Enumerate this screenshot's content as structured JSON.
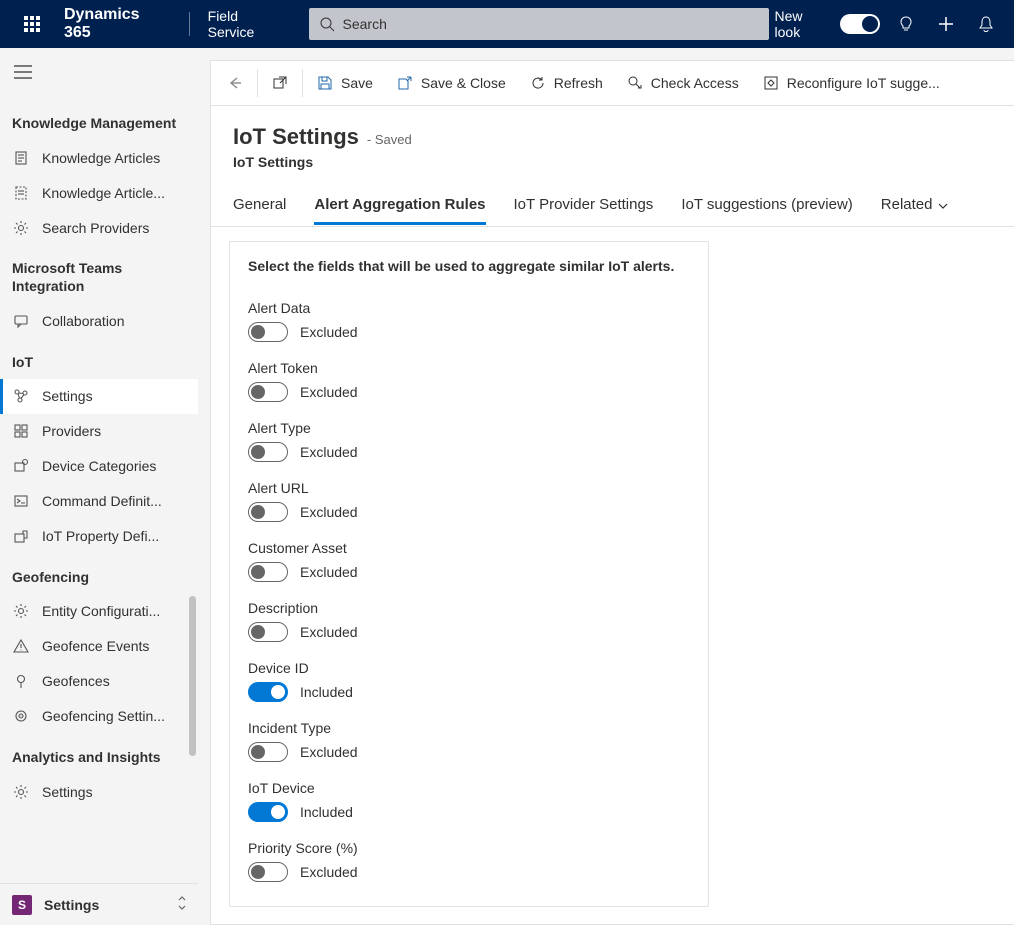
{
  "header": {
    "brand": "Dynamics 365",
    "app": "Field Service",
    "search_placeholder": "Search",
    "new_look_label": "New look"
  },
  "sidebar": {
    "groups": [
      {
        "title": "Knowledge Management",
        "items": [
          {
            "id": "knowledge-articles",
            "label": "Knowledge Articles",
            "icon": "doc"
          },
          {
            "id": "knowledge-article-templates",
            "label": "Knowledge Article...",
            "icon": "doc-dash"
          },
          {
            "id": "search-providers",
            "label": "Search Providers",
            "icon": "gear"
          }
        ]
      },
      {
        "title": "Microsoft Teams Integration",
        "items": [
          {
            "id": "collaboration",
            "label": "Collaboration",
            "icon": "chat"
          }
        ]
      },
      {
        "title": "IoT",
        "items": [
          {
            "id": "iot-settings",
            "label": "Settings",
            "icon": "nodes",
            "selected": true
          },
          {
            "id": "providers",
            "label": "Providers",
            "icon": "grid"
          },
          {
            "id": "device-categories",
            "label": "Device Categories",
            "icon": "device"
          },
          {
            "id": "command-definitions",
            "label": "Command Definit...",
            "icon": "cmd"
          },
          {
            "id": "iot-property-definitions",
            "label": "IoT Property Defi...",
            "icon": "prop"
          }
        ]
      },
      {
        "title": "Geofencing",
        "items": [
          {
            "id": "entity-config",
            "label": "Entity Configurati...",
            "icon": "gear"
          },
          {
            "id": "geofence-events",
            "label": "Geofence Events",
            "icon": "warn"
          },
          {
            "id": "geofences",
            "label": "Geofences",
            "icon": "pin"
          },
          {
            "id": "geofencing-settings",
            "label": "Geofencing Settin...",
            "icon": "target"
          }
        ]
      },
      {
        "title": "Analytics and Insights",
        "items": [
          {
            "id": "analytics-settings",
            "label": "Settings",
            "icon": "gear"
          }
        ]
      }
    ],
    "app_switch": {
      "badge": "S",
      "label": "Settings"
    }
  },
  "commands": {
    "back": "",
    "popout": "",
    "save": "Save",
    "save_close": "Save & Close",
    "refresh": "Refresh",
    "check_access": "Check Access",
    "reconfigure": "Reconfigure IoT sugge..."
  },
  "page": {
    "title": "IoT Settings",
    "saved_suffix": "- Saved",
    "subtitle": "IoT Settings",
    "tabs": [
      {
        "id": "general",
        "label": "General"
      },
      {
        "id": "alert-agg",
        "label": "Alert Aggregation Rules",
        "active": true
      },
      {
        "id": "provider-settings",
        "label": "IoT Provider Settings"
      },
      {
        "id": "suggestions",
        "label": "IoT suggestions (preview)"
      },
      {
        "id": "related",
        "label": "Related",
        "dropdown": true
      }
    ],
    "help_text": "Select the fields that will be used to aggregate similar IoT alerts.",
    "included_label": "Included",
    "excluded_label": "Excluded",
    "fields": [
      {
        "label": "Alert Data",
        "on": false
      },
      {
        "label": "Alert Token",
        "on": false
      },
      {
        "label": "Alert Type",
        "on": false
      },
      {
        "label": "Alert URL",
        "on": false
      },
      {
        "label": "Customer Asset",
        "on": false
      },
      {
        "label": "Description",
        "on": false
      },
      {
        "label": "Device ID",
        "on": true
      },
      {
        "label": "Incident Type",
        "on": false
      },
      {
        "label": "IoT Device",
        "on": true
      },
      {
        "label": "Priority Score (%)",
        "on": false
      }
    ]
  }
}
